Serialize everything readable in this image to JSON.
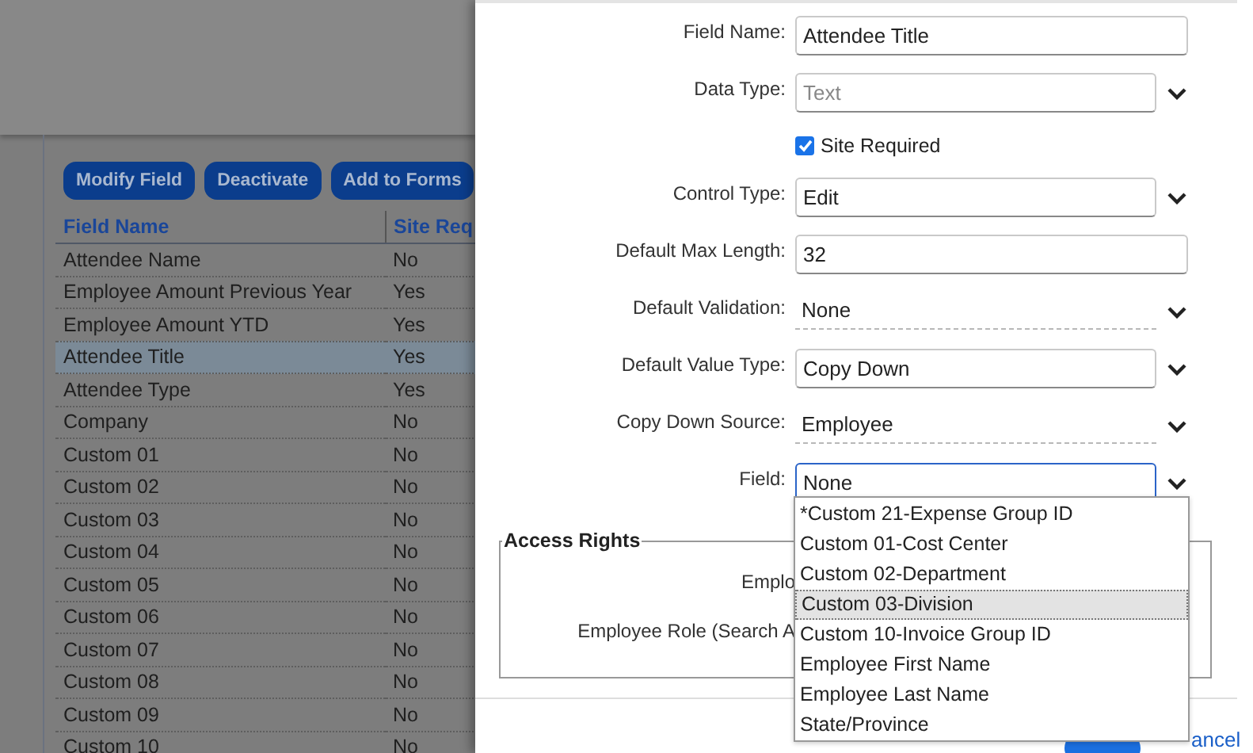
{
  "background_page": {
    "buttons": [
      "Modify Field",
      "Deactivate",
      "Add to Forms"
    ],
    "table": {
      "columns": [
        "Field Name",
        "Site Req"
      ],
      "rows": [
        {
          "cells": [
            "Attendee Name",
            "No"
          ],
          "selected": false
        },
        {
          "cells": [
            "Employee Amount Previous Year",
            "Yes"
          ],
          "selected": false
        },
        {
          "cells": [
            "Employee Amount YTD",
            "Yes"
          ],
          "selected": false
        },
        {
          "cells": [
            "Attendee Title",
            "Yes"
          ],
          "selected": true
        },
        {
          "cells": [
            "Attendee Type",
            "Yes"
          ],
          "selected": false
        },
        {
          "cells": [
            "Company",
            "No"
          ],
          "selected": false
        },
        {
          "cells": [
            "Custom 01",
            "No"
          ],
          "selected": false
        },
        {
          "cells": [
            "Custom 02",
            "No"
          ],
          "selected": false
        },
        {
          "cells": [
            "Custom 03",
            "No"
          ],
          "selected": false
        },
        {
          "cells": [
            "Custom 04",
            "No"
          ],
          "selected": false
        },
        {
          "cells": [
            "Custom 05",
            "No"
          ],
          "selected": false
        },
        {
          "cells": [
            "Custom 06",
            "No"
          ],
          "selected": false
        },
        {
          "cells": [
            "Custom 07",
            "No"
          ],
          "selected": false
        },
        {
          "cells": [
            "Custom 08",
            "No"
          ],
          "selected": false
        },
        {
          "cells": [
            "Custom 09",
            "No"
          ],
          "selected": false
        },
        {
          "cells": [
            "Custom 10",
            "No"
          ],
          "selected": false
        }
      ]
    }
  },
  "dialog": {
    "fields": [
      {
        "kind": "text",
        "label": "Field Name:",
        "value": "Attendee Title"
      },
      {
        "kind": "select",
        "label": "Data Type:",
        "value": "Text",
        "disabled": true,
        "focused": false
      },
      {
        "kind": "checkbox",
        "label": "Site Required",
        "checked": true
      },
      {
        "kind": "select",
        "label": "Control Type:",
        "value": "Edit",
        "disabled": false,
        "focused": false
      },
      {
        "kind": "text",
        "label": "Default Max Length:",
        "value": "32"
      },
      {
        "kind": "plain-select",
        "label": "Default Validation:",
        "value": "None"
      },
      {
        "kind": "select",
        "label": "Default Value Type:",
        "value": "Copy Down",
        "disabled": false,
        "focused": false
      },
      {
        "kind": "plain-select",
        "label": "Copy Down Source:",
        "value": "Employee"
      },
      {
        "kind": "select",
        "label": "Field:",
        "value": "None",
        "disabled": false,
        "focused": true
      }
    ],
    "dropdown_options": [
      {
        "label": "*Custom 21-Expense Group ID",
        "selected": false
      },
      {
        "label": "Custom 01-Cost Center",
        "selected": false
      },
      {
        "label": "Custom 02-Department",
        "selected": false
      },
      {
        "label": "Custom 03-Division",
        "selected": true
      },
      {
        "label": "Custom 10-Invoice Group ID",
        "selected": false
      },
      {
        "label": "Employee First Name",
        "selected": false
      },
      {
        "label": "Employee Last Name",
        "selected": false
      },
      {
        "label": "State/Province",
        "selected": false
      }
    ],
    "access_rights": {
      "title": "Access Rights",
      "labels": [
        "Emplo",
        "Employee Role (Search A"
      ]
    },
    "cancel_link": "ancel"
  }
}
